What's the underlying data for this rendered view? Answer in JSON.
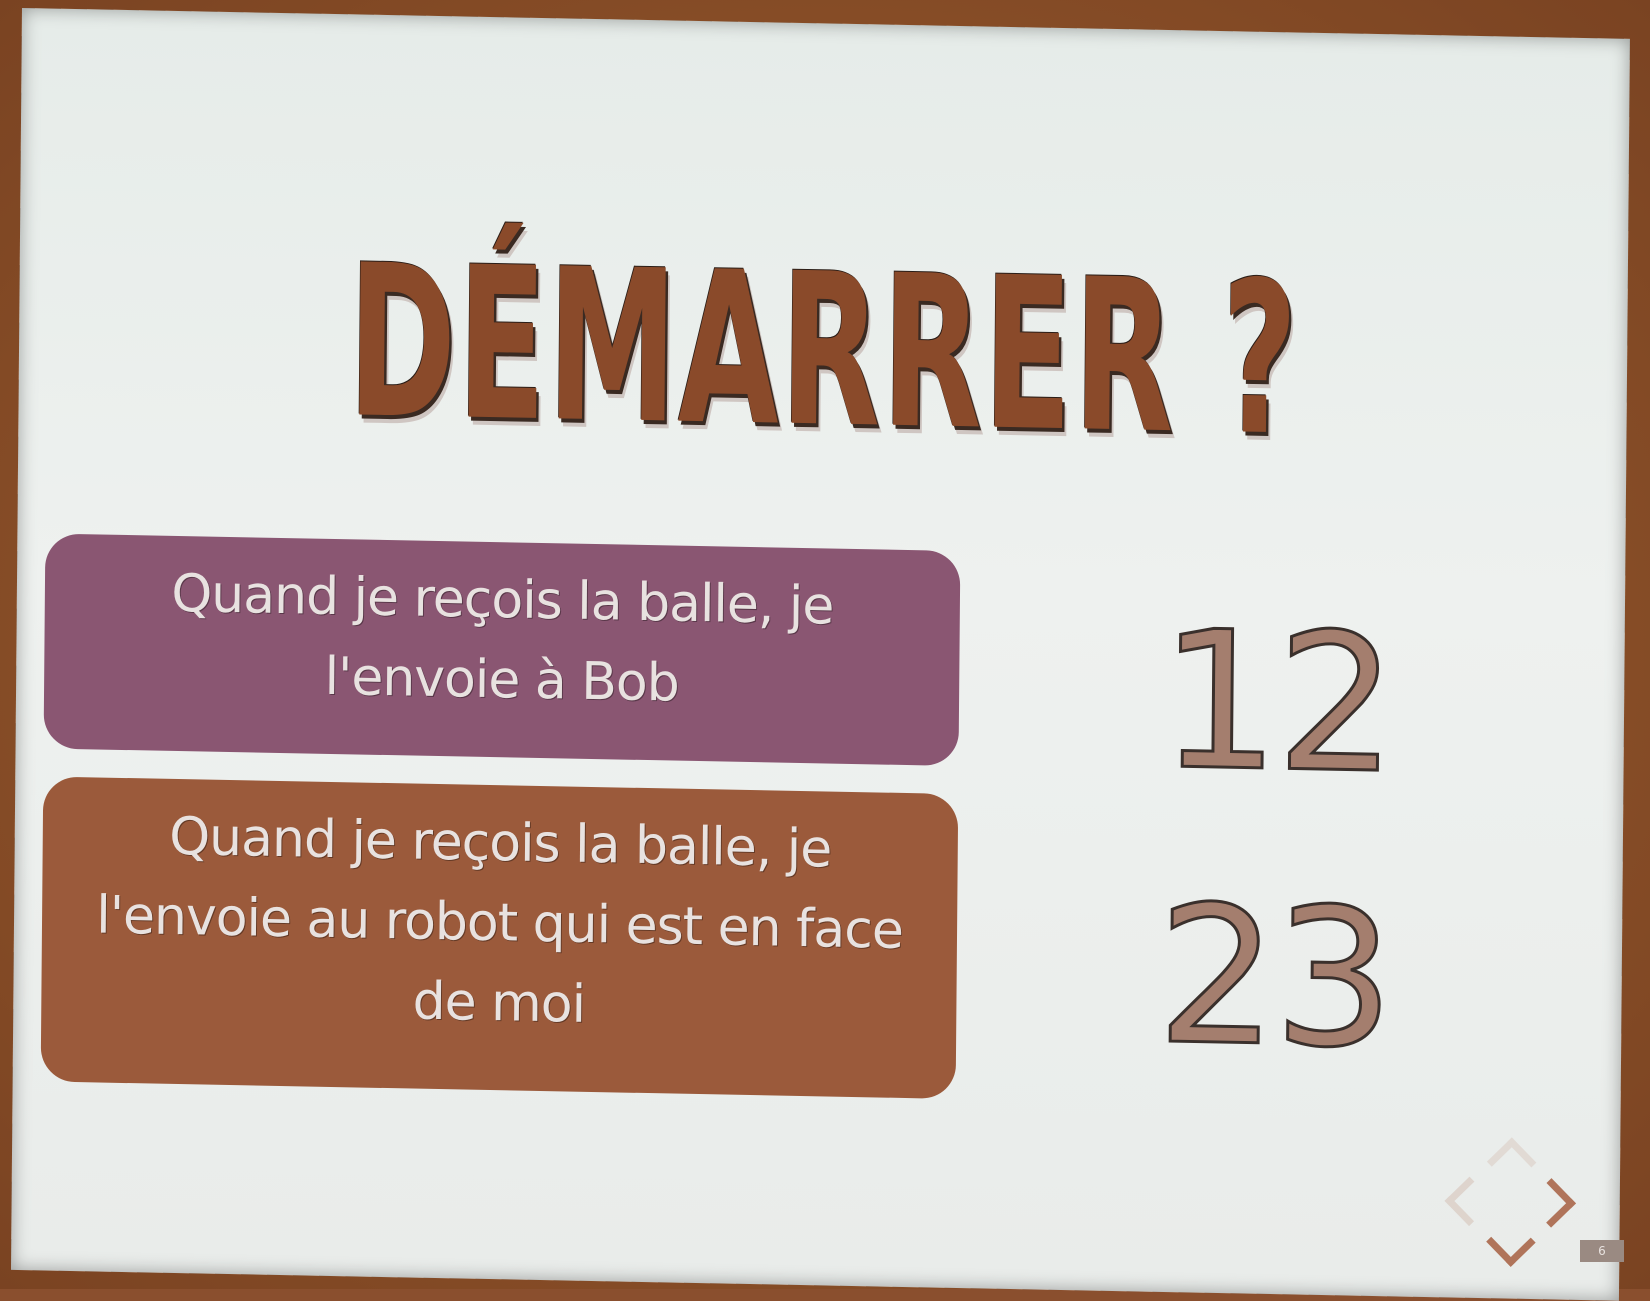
{
  "slide": {
    "title": "DÉMARRER ?",
    "options": [
      {
        "text_lines": [
          "Quand je reçois la balle, je",
          "l'envoie à Bob"
        ],
        "count": "12"
      },
      {
        "text_lines": [
          "Quand je reçois la balle, je",
          "l'envoie au robot qui est en face",
          "de moi"
        ],
        "count": "23"
      }
    ],
    "slide_number": "6"
  },
  "colors": {
    "title": "#8a4a2a",
    "option_1_bg": "#8a5672",
    "option_2_bg": "#9b5a3b",
    "nav_arrows": "#b0745a"
  },
  "icons": {
    "nav_up": "chevron-up-icon",
    "nav_left": "chevron-left-icon",
    "nav_right": "chevron-right-icon",
    "nav_down": "chevron-down-icon"
  }
}
